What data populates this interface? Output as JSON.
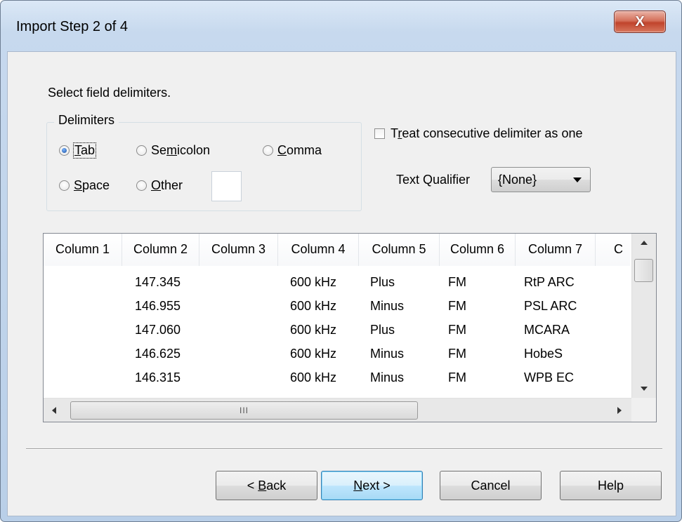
{
  "window": {
    "title": "Import Step 2 of 4",
    "close_glyph": "X"
  },
  "instruction": "Select field delimiters.",
  "delimiters": {
    "group_label": "Delimiters",
    "options": [
      {
        "pre": "",
        "key": "T",
        "post": "ab",
        "checked": true
      },
      {
        "pre": "Se",
        "key": "m",
        "post": "icolon",
        "checked": false
      },
      {
        "pre": "",
        "key": "C",
        "post": "omma",
        "checked": false
      },
      {
        "pre": "",
        "key": "S",
        "post": "pace",
        "checked": false
      },
      {
        "pre": "",
        "key": "O",
        "post": "ther",
        "checked": false
      }
    ],
    "other_value": ""
  },
  "consecutive": {
    "pre": "T",
    "key": "r",
    "post": "eat consecutive delimiter as one",
    "checked": false
  },
  "text_qualifier": {
    "label": "Text Qualifier",
    "value": "{None}"
  },
  "preview": {
    "headers": [
      "Column 1",
      "Column 2",
      "Column 3",
      "Column 4",
      "Column 5",
      "Column 6",
      "Column 7",
      "C"
    ],
    "rows": [
      [
        "",
        "147.345",
        "",
        "600 kHz",
        "Plus",
        "FM",
        "RtP ARC",
        ""
      ],
      [
        "",
        "146.955",
        "",
        "600 kHz",
        "Minus",
        "FM",
        "PSL ARC",
        ""
      ],
      [
        "",
        "147.060",
        "",
        "600 kHz",
        "Plus",
        "FM",
        "MCARA",
        ""
      ],
      [
        "",
        "146.625",
        "",
        "600 kHz",
        "Minus",
        "FM",
        "HobeS",
        ""
      ],
      [
        "",
        "146.315",
        "",
        "600 kHz",
        "Minus",
        "FM",
        "WPB EC",
        ""
      ]
    ],
    "hscroll_grip": "III"
  },
  "buttons": {
    "back": {
      "pre": "< ",
      "key": "B",
      "post": "ack"
    },
    "next": {
      "pre": "",
      "key": "N",
      "post": "ext >"
    },
    "cancel": {
      "label": "Cancel"
    },
    "help": {
      "label": "Help"
    }
  }
}
